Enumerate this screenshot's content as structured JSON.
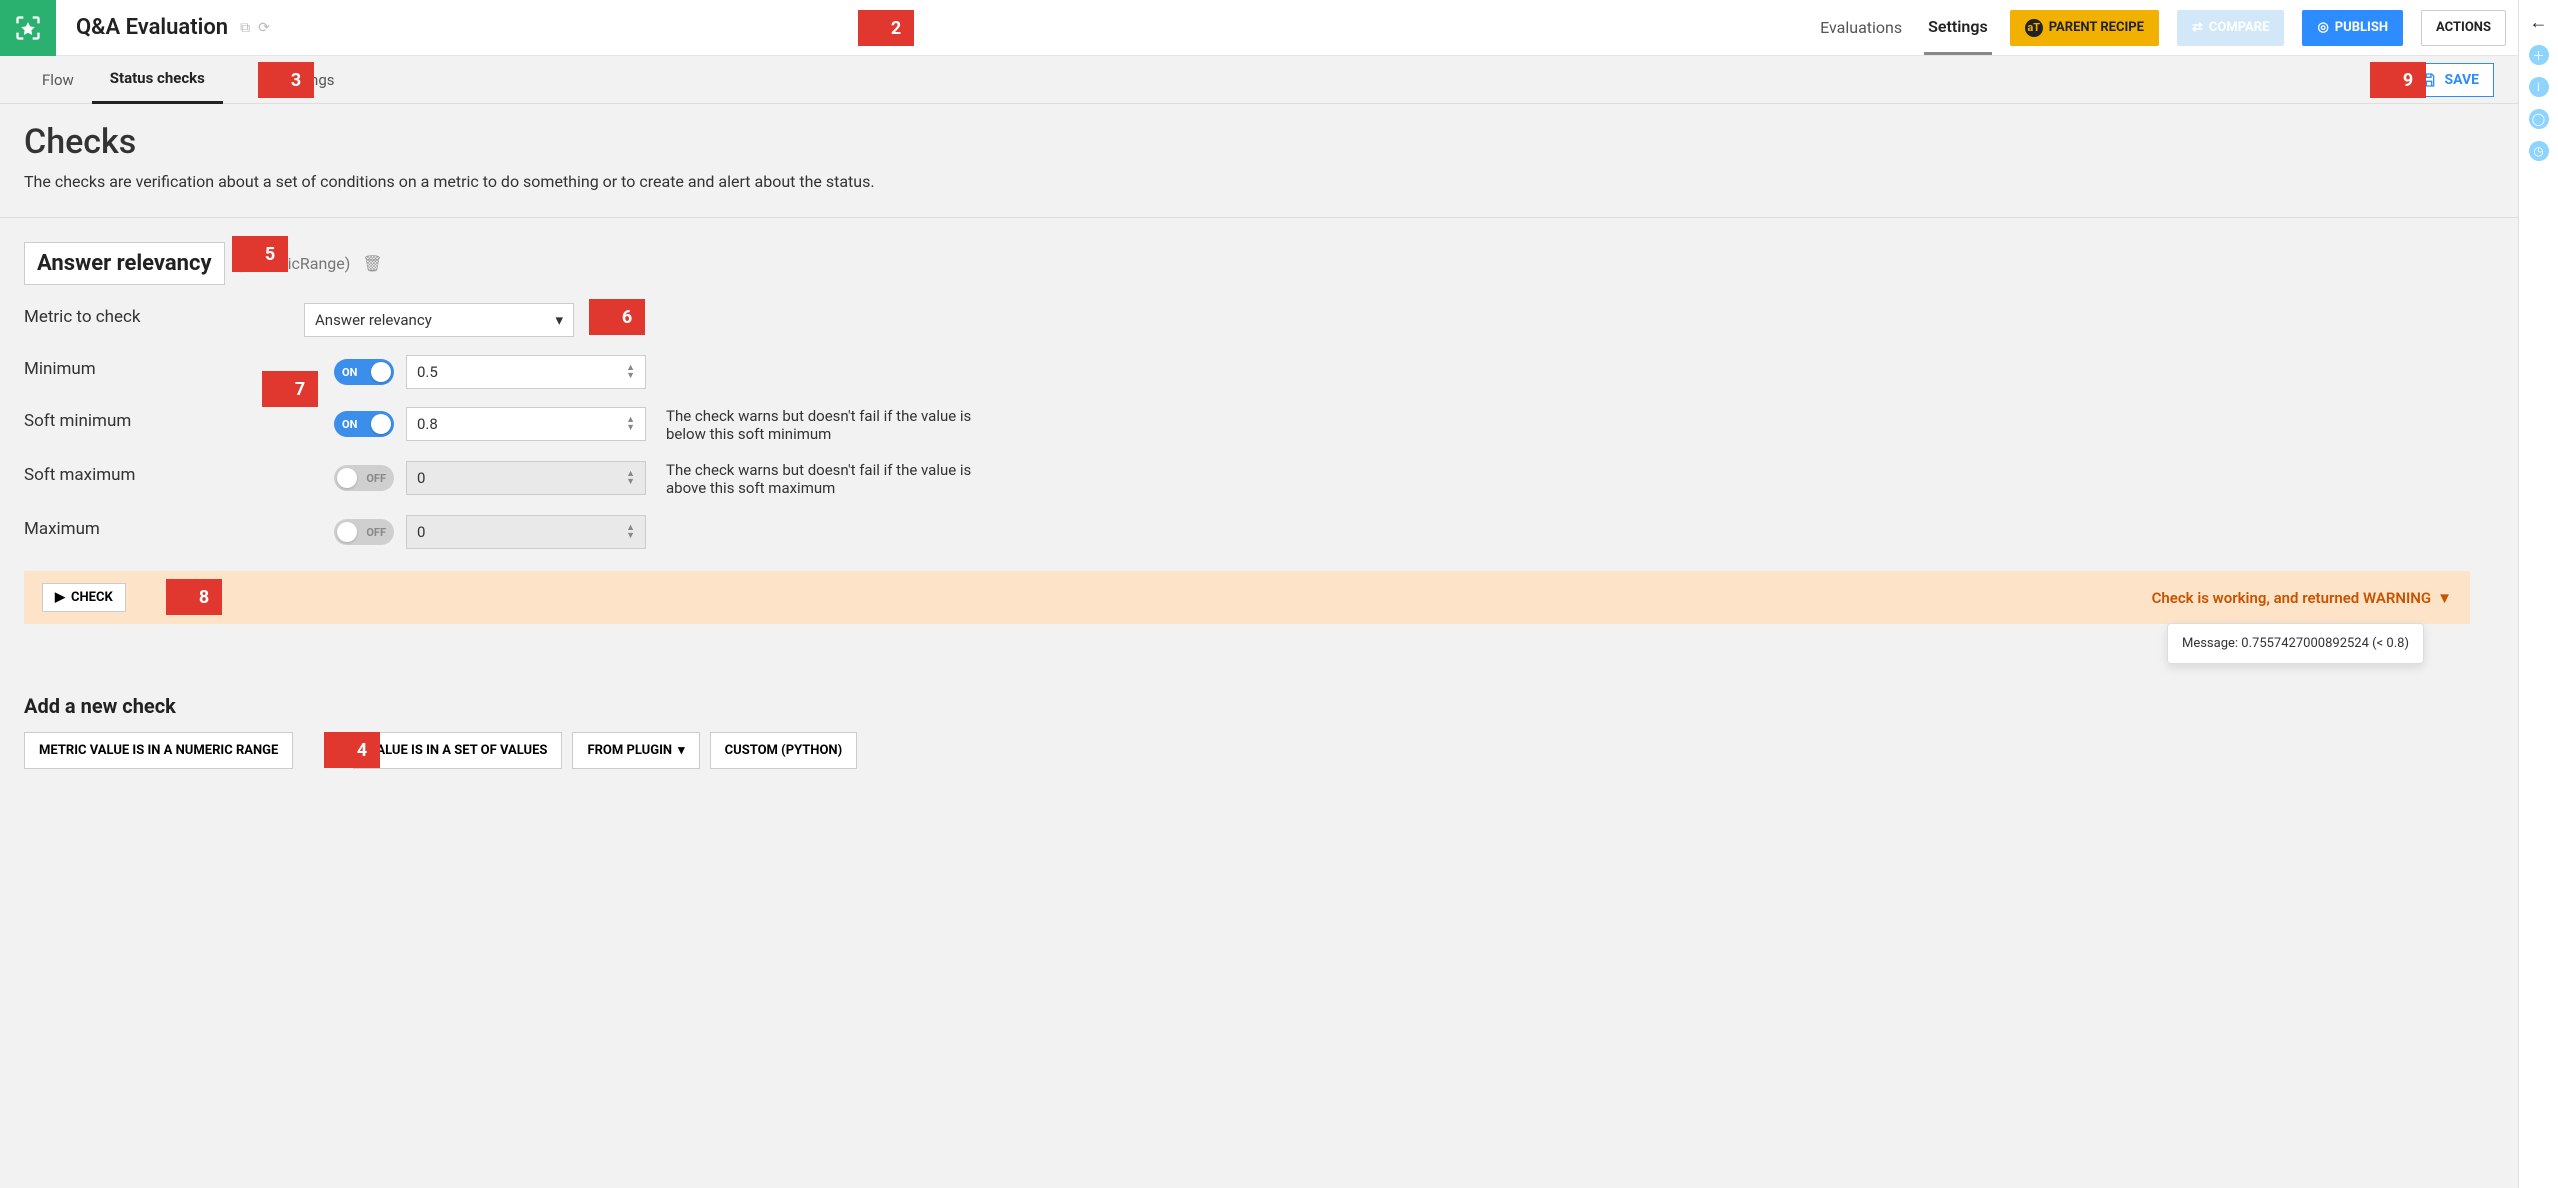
{
  "header": {
    "title": "Q&A Evaluation",
    "nav": {
      "evaluations": "Evaluations",
      "settings": "Settings"
    },
    "buttons": {
      "parent": "PARENT RECIPE",
      "compare": "COMPARE",
      "publish": "PUBLISH",
      "actions": "ACTIONS"
    }
  },
  "subtabs": {
    "flow": "Flow",
    "status": "Status checks",
    "settings": "settings",
    "save": "SAVE"
  },
  "page": {
    "heading": "Checks",
    "subtitle": "The checks are verification about a set of conditions on a metric to do something or to create and alert about the status."
  },
  "check": {
    "name": "Answer relevancy",
    "type_display": "(numericRange)",
    "metric_label": "Metric to check",
    "metric_value": "Answer relevancy",
    "rows": {
      "min": {
        "label": "Minimum",
        "on": true,
        "value": "0.5",
        "hint": ""
      },
      "softmin": {
        "label": "Soft minimum",
        "on": true,
        "value": "0.8",
        "hint": "The check warns but doesn't fail if the value is below this soft minimum"
      },
      "softmax": {
        "label": "Soft maximum",
        "on": false,
        "value": "0",
        "hint": "The check warns but doesn't fail if the value is above this soft maximum"
      },
      "max": {
        "label": "Maximum",
        "on": false,
        "value": "0",
        "hint": ""
      }
    },
    "toggle_on_label": "ON",
    "toggle_off_label": "OFF",
    "run_button": "CHECK",
    "status_text": "Check is working, and returned WARNING",
    "status_message": "Message: 0.7557427000892524 (< 0.8)"
  },
  "addnew": {
    "heading": "Add a new check",
    "buttons": {
      "range": "METRIC VALUE IS IN A NUMERIC RANGE",
      "set": "VALUE IS IN A SET OF VALUES",
      "plugin": "FROM PLUGIN",
      "custom": "CUSTOM (PYTHON)"
    }
  },
  "callouts": {
    "n2": "2",
    "n3": "3",
    "n4": "4",
    "n5": "5",
    "n6": "6",
    "n7": "7",
    "n8": "8",
    "n9": "9"
  }
}
